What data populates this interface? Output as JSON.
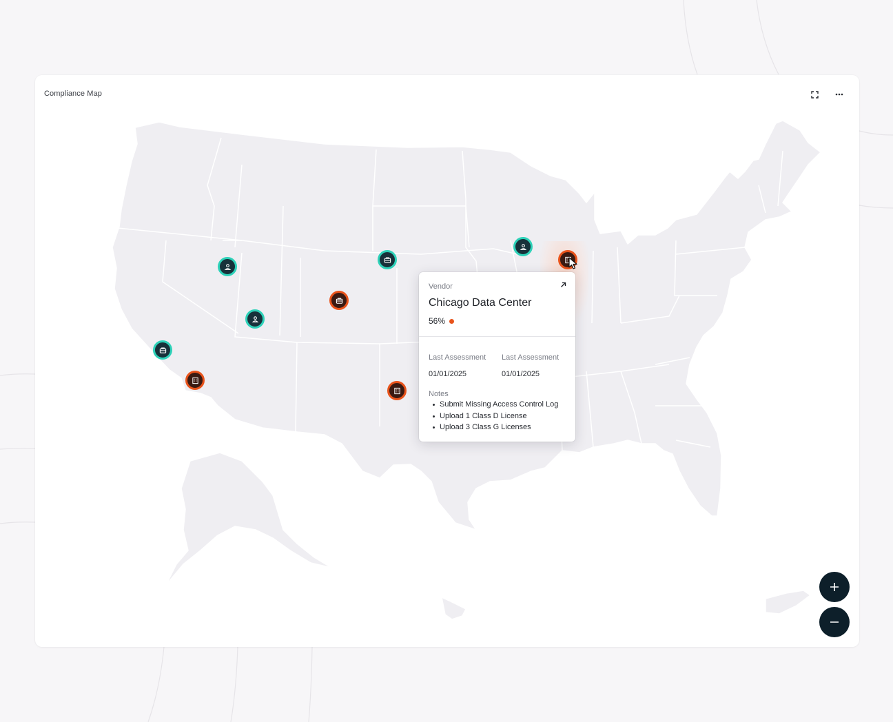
{
  "card": {
    "title": "Compliance Map"
  },
  "toolbar": {
    "expand_icon": "expand-icon",
    "more_icon": "more-horizontal-icon"
  },
  "colors": {
    "map_fill": "#efeef2",
    "map_stroke": "#ffffff",
    "teal_ring": "#2ed2b9",
    "orange_ring": "#e8531b",
    "zoom_button": "#0d1f2a"
  },
  "markers": [
    {
      "kind": "person",
      "status": "teal"
    },
    {
      "kind": "briefcase",
      "status": "teal"
    },
    {
      "kind": "person",
      "status": "teal"
    },
    {
      "kind": "building",
      "status": "orange"
    },
    {
      "kind": "briefcase",
      "status": "teal"
    },
    {
      "kind": "briefcase",
      "status": "orange"
    },
    {
      "kind": "person",
      "status": "teal"
    },
    {
      "kind": "building",
      "status": "orange"
    },
    {
      "kind": "building",
      "status": "orange"
    }
  ],
  "tooltip": {
    "type_label": "Vendor",
    "name": "Chicago Data Center",
    "score": "56%",
    "assessment_1_label": "Last Assessment",
    "assessment_1_value": "01/01/2025",
    "assessment_2_label": "Last Assessment",
    "assessment_2_value": "01/01/2025",
    "notes_label": "Notes",
    "notes": [
      "Submit Missing Access Control Log",
      "Upload 1 Class D License",
      "Upload 3 Class G Licenses"
    ]
  },
  "zoom": {
    "in_icon": "plus-icon",
    "out_icon": "minus-icon"
  }
}
